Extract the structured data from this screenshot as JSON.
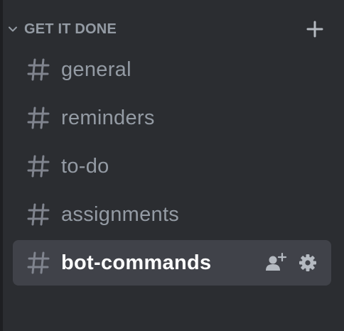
{
  "category": {
    "label": "GET IT DONE",
    "collapse_icon": "chevron-down-icon",
    "add_icon": "plus-icon"
  },
  "channels": [
    {
      "name": "general",
      "icon": "hash-icon",
      "selected": false
    },
    {
      "name": "reminders",
      "icon": "hash-icon",
      "selected": false
    },
    {
      "name": "to-do",
      "icon": "hash-icon",
      "selected": false
    },
    {
      "name": "assignments",
      "icon": "hash-icon",
      "selected": false
    },
    {
      "name": "bot-commands",
      "icon": "hash-icon",
      "selected": true
    }
  ],
  "selected_channel_actions": [
    "add-member-icon",
    "settings-gear-icon"
  ],
  "colors": {
    "background": "#2b2d31",
    "selected_background": "#404249",
    "muted_text": "#949ba4",
    "active_text": "#ffffff",
    "icon": "#80848e"
  }
}
